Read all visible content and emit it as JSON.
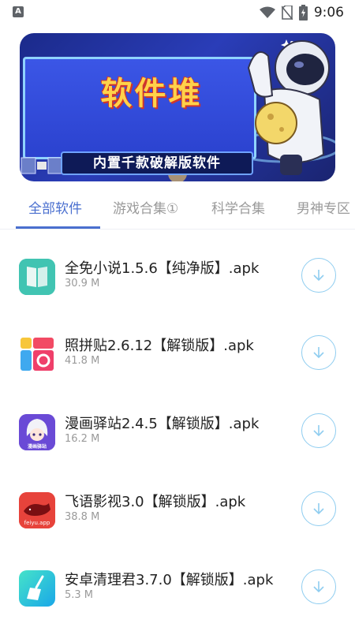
{
  "status_bar": {
    "notification_icon": "a-notification-icon",
    "time": "9:06",
    "icons": [
      "wifi-icon",
      "no-sim-icon",
      "battery-charging-icon"
    ]
  },
  "banner": {
    "title": "软件堆",
    "subtitle": "内置千款破解版软件"
  },
  "tabs": [
    {
      "label": "全部软件",
      "active": true
    },
    {
      "label": "游戏合集①",
      "active": false
    },
    {
      "label": "科学合集",
      "active": false
    },
    {
      "label": "男神专区",
      "active": false
    }
  ],
  "colors": {
    "accent": "#4a6fcf",
    "download_ring": "#8fcdf0",
    "muted_text": "#9a9a9a"
  },
  "apps": [
    {
      "name": "全免小说1.5.6【纯净版】.apk",
      "size": "30.9 M",
      "icon": "book-icon"
    },
    {
      "name": "照拼贴2.6.12【解锁版】.apk",
      "size": "41.8 M",
      "icon": "photo-collage-icon"
    },
    {
      "name": "漫画驿站2.4.5【解锁版】.apk",
      "size": "16.2 M",
      "icon": "manga-avatar-icon",
      "icon_label": "漫画驿站"
    },
    {
      "name": "飞语影视3.0【解锁版】.apk",
      "size": "38.8 M",
      "icon": "whale-icon",
      "icon_label": "feiyu.app"
    },
    {
      "name": "安卓清理君3.7.0【解锁版】.apk",
      "size": "5.3 M",
      "icon": "broom-icon"
    }
  ]
}
